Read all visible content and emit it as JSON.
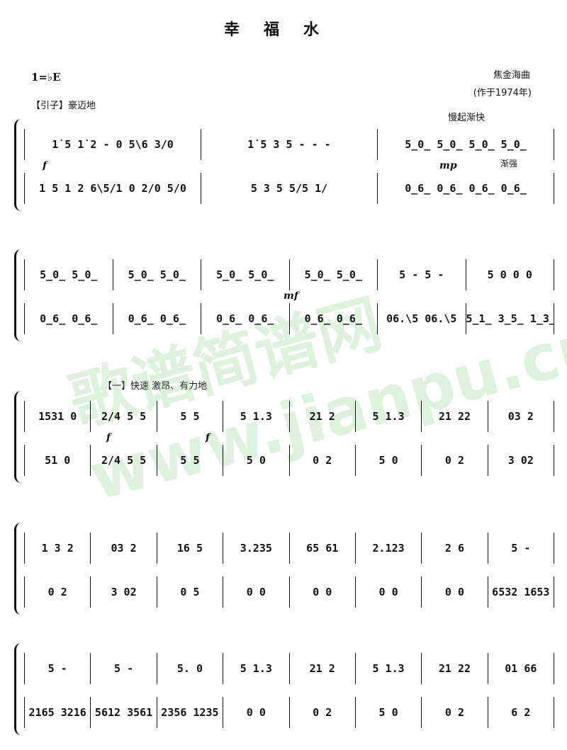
{
  "title": "幸福水",
  "key": "1=♭E",
  "composer": "焦金海曲",
  "year": "(作于1974年)",
  "intro_label": "【引子】豪迈地",
  "tempo_change": "慢起渐快",
  "section1_label": "【一】快速  激昂、有力地",
  "free_meter": "サ",
  "crescendo": "渐强",
  "watermark": "歌谱简谱网 www.jianpu.cn",
  "systems": [
    {
      "upper": [
        "1̇ 5 1̇ 2 - 0 5\\6 3/0",
        "1̇ 5 3 5 - - -",
        "5̲0̲ 5̲0̲ 5̲0̲ 5̲0̲"
      ],
      "lower": [
        "1 5 1 2 6\\5/1 0 2/0 5/0",
        "5 3 5 5/5 1/",
        "0̲6̲ 0̲6̲ 0̲6̲ 0̲6̲"
      ],
      "dynamics": [
        "f",
        "mp"
      ]
    },
    {
      "upper": [
        "5̲0̲ 5̲0̲",
        "5̲0̲ 5̲0̲",
        "5̲0̲ 5̲0̲",
        "5̲0̲ 5̲0̲",
        "5 - 5 -",
        "5 0 0 0"
      ],
      "lower": [
        "0̲6̲ 0̲6̲",
        "0̲6̲ 0̲6̲",
        "0̲6̲ 0̲6̲",
        "0̲6̲ 0̲6̲",
        "06.\\5 06.\\5",
        "5̲1̲ 3̲5̲ 1̲3̲ 5̲6̲"
      ],
      "dynamics": [
        "mf"
      ]
    },
    {
      "upper": [
        "1531 0",
        "2/4 5 5",
        "5 5",
        "5 1.3",
        "21 2",
        "5 1.3",
        "21 22",
        "03 2"
      ],
      "lower": [
        "51 0",
        "2/4 5 5",
        "5 5",
        "5 0",
        "0 2",
        "5 0",
        "0 2",
        "3 02"
      ],
      "dynamics": [
        "f",
        "f"
      ]
    },
    {
      "upper": [
        "1 3 2",
        "03 2",
        "16 5",
        "3.235",
        "65 61",
        "2.123",
        "2 6",
        "5 -"
      ],
      "lower": [
        "0 2",
        "3 02",
        "0 5",
        "0 0",
        "0 0",
        "0 0",
        "0 0",
        "6532 1653"
      ],
      "dynamics": []
    },
    {
      "upper": [
        "5 -",
        "5 -",
        "5. 0",
        "5 1.3",
        "21 2",
        "5 1.3",
        "21 22",
        "01 66"
      ],
      "lower": [
        "2165 3216",
        "5612 3561",
        "2356 1235",
        "0 0",
        "0 2",
        "5 0",
        "0 2",
        "6 2"
      ],
      "dynamics": []
    }
  ]
}
